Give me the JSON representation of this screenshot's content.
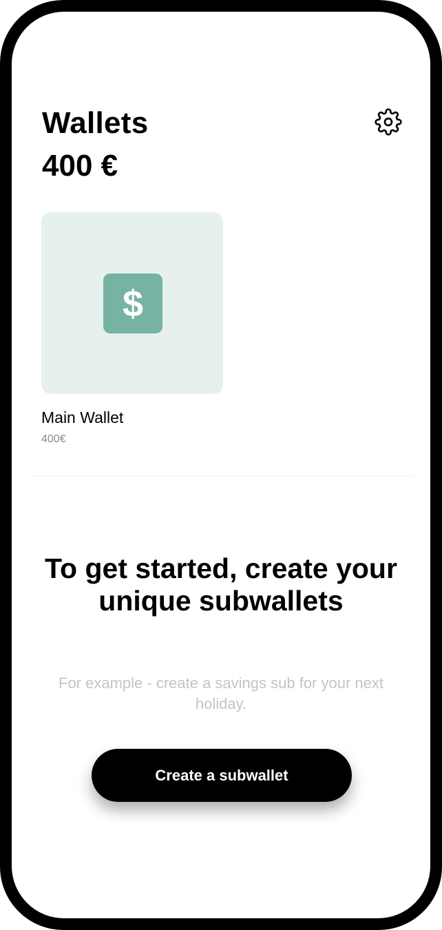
{
  "header": {
    "title": "Wallets",
    "total_balance": "400 €",
    "settings_icon": "gear-icon"
  },
  "wallets": [
    {
      "name": "Main Wallet",
      "amount": "400€",
      "icon": "dollar-icon",
      "icon_glyph": "$",
      "card_color": "#e6f1ee",
      "icon_color": "#77b3a3"
    }
  ],
  "empty_state": {
    "headline": "To get started, create your unique subwallets",
    "description": "For example - create a savings sub for your next holiday.",
    "button_label": "Create a subwallet"
  }
}
